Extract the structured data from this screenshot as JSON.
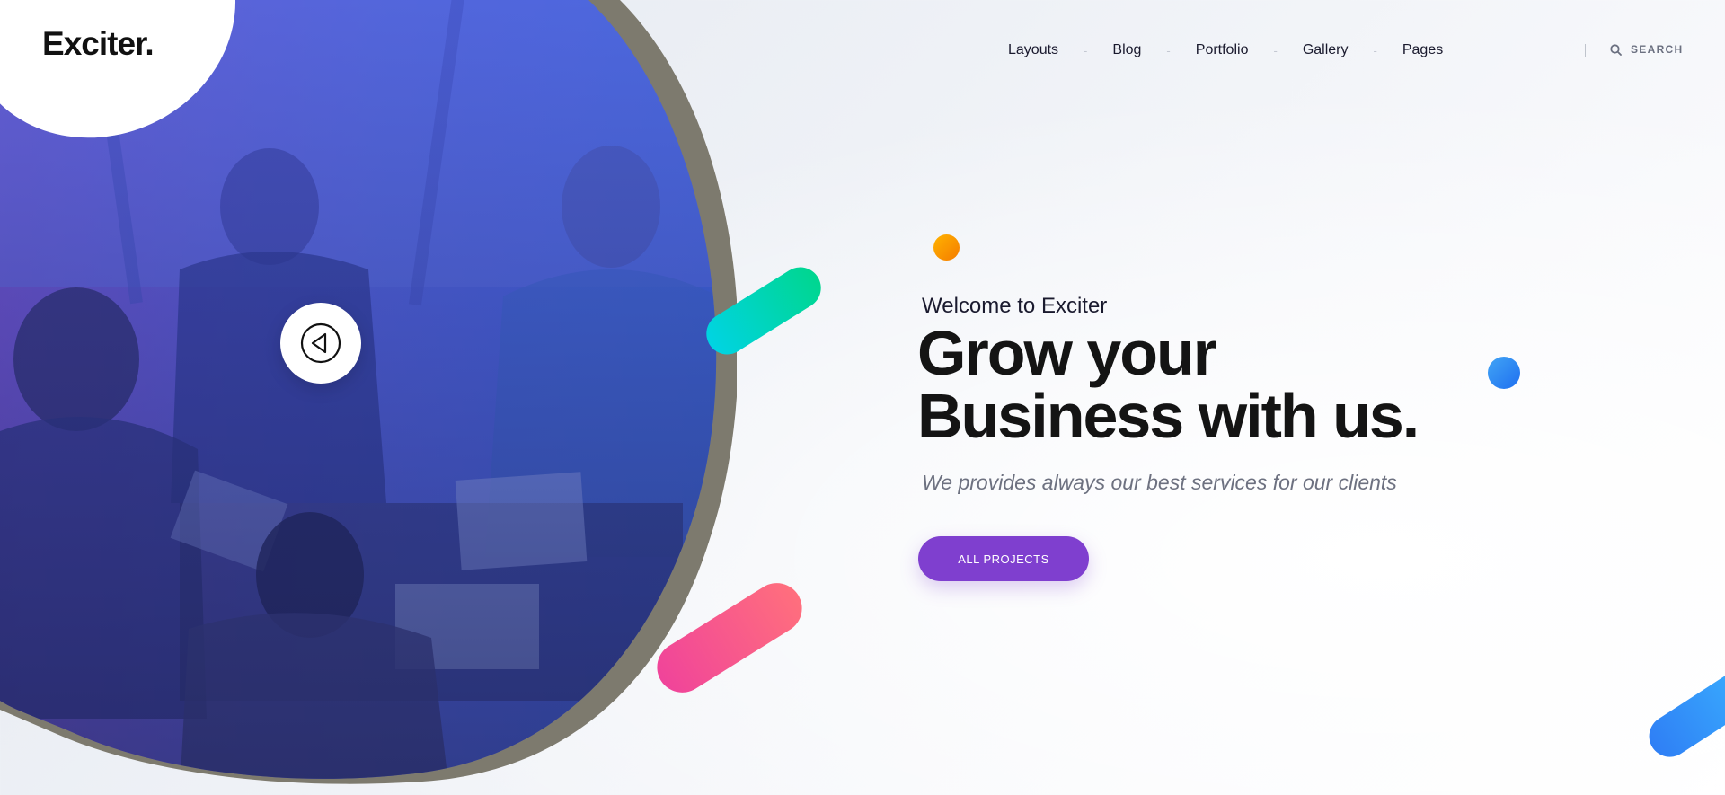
{
  "brand": {
    "logo_text": "Exciter.",
    "primary_color": "#7f3fcf",
    "photo_overlay_color": "#4a5fd6"
  },
  "nav": {
    "items": [
      {
        "label": "Layouts"
      },
      {
        "label": "Blog"
      },
      {
        "label": "Portfolio"
      },
      {
        "label": "Gallery"
      },
      {
        "label": "Pages"
      }
    ],
    "separator": "-",
    "search_label": "SEARCH"
  },
  "hero": {
    "welcome": "Welcome to Exciter",
    "headline_line1": "Grow your",
    "headline_line2": "Business with us.",
    "subtitle": "We provides always our best services for our clients",
    "cta_label": "ALL PROJECTS",
    "play_icon": "play-back-icon"
  },
  "decor": {
    "dot_orange": "#f59b00",
    "dot_blue": "#2f8cf5",
    "pill_green": "#00d4b0",
    "pill_pink": "#f4527e",
    "pill_blue": "#2f8cf5"
  }
}
